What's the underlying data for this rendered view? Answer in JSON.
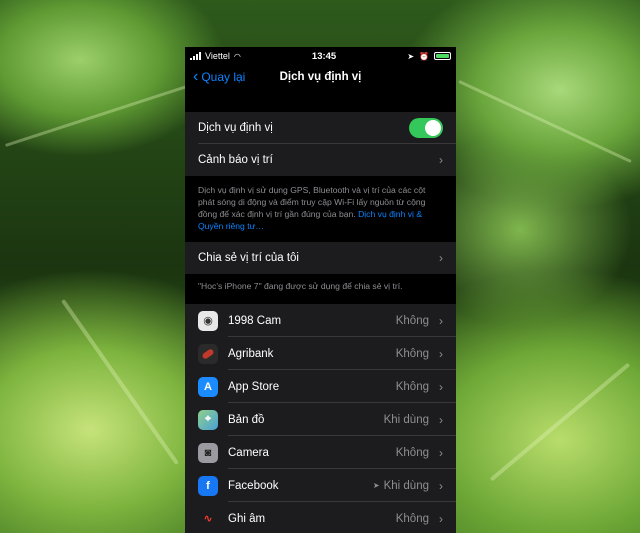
{
  "status": {
    "carrier": "Viettel",
    "time": "13:45",
    "battery": ""
  },
  "nav": {
    "back_label": "Quay lại",
    "title": "Dịch vụ định vị"
  },
  "location_services": {
    "label": "Dịch vụ định vị",
    "enabled": true
  },
  "location_alerts": {
    "label": "Cảnh báo vị trí"
  },
  "description": {
    "text": "Dịch vụ định vị sử dụng GPS, Bluetooth và vị trí của các cột phát sóng di động và điểm truy cập Wi-Fi lấy nguồn từ cộng đồng để xác định vị trí gần đúng của bạn. ",
    "link": "Dịch vụ định vị & Quyền riêng tư…"
  },
  "share_location": {
    "label": "Chia sẻ vị trí của tôi",
    "note": "\"Hoc's iPhone 7\" đang được sử dụng để chia sẻ vị trí."
  },
  "apps": [
    {
      "name": "1998 Cam",
      "value": "Không",
      "icon": "1998-cam-icon",
      "color": "#e8e8e8"
    },
    {
      "name": "Agribank",
      "value": "Không",
      "icon": "agribank-icon",
      "color": "#2a2a2a"
    },
    {
      "name": "App Store",
      "value": "Không",
      "icon": "app-store-icon",
      "color": "#1a8cff"
    },
    {
      "name": "Bản đồ",
      "value": "Khi dùng",
      "icon": "maps-icon",
      "color": "#5fb86a"
    },
    {
      "name": "Camera",
      "value": "Không",
      "icon": "camera-icon",
      "color": "#8e8e93"
    },
    {
      "name": "Facebook",
      "value": "Khi dùng",
      "icon": "facebook-icon",
      "color": "#1877f2",
      "recent": true
    },
    {
      "name": "Ghi âm",
      "value": "Không",
      "icon": "voice-memos-icon",
      "color": "#1c1c1e"
    }
  ]
}
